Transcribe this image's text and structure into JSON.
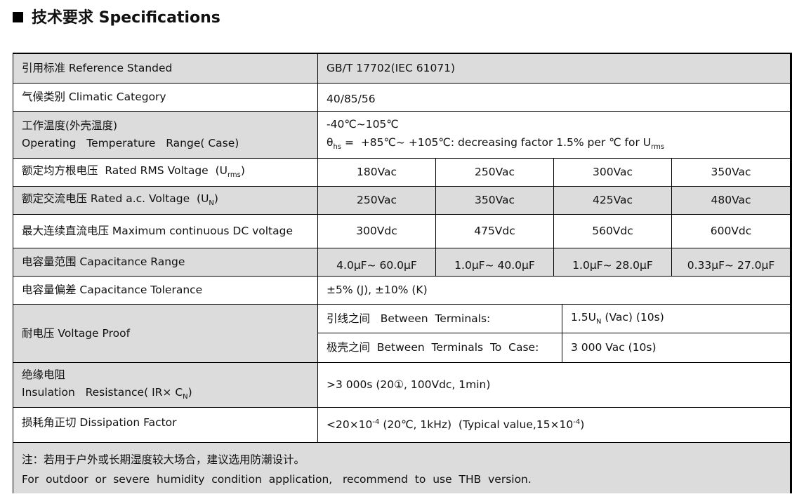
{
  "heading": {
    "bullet": "■",
    "title": "技术要求 Specifications"
  },
  "rows": {
    "reference": {
      "label": "引用标准  Reference  Standed",
      "value": "GB/T 17702(IEC 61071)"
    },
    "climatic": {
      "label": "气候类别  Climatic Category",
      "value": "40/85/56"
    },
    "temperature": {
      "label_cn": "工作温度(外壳温度)",
      "label_en": "Operating   Temperature   Range( Case)",
      "value_line1": "-40℃~105℃",
      "value_line2_pre": "θ",
      "value_line2_sub": "hs",
      "value_line2_mid": " =  +85℃~ +105℃: decreasing factor 1.5% per ℃ for U",
      "value_line2_sub2": "rms"
    },
    "rms_voltage": {
      "label_pre": "额定均方根电压  Rated RMS Voltage  (U",
      "label_sub": "rms",
      "label_post": ")",
      "values": [
        "180Vac",
        "250Vac",
        "300Vac",
        "350Vac"
      ]
    },
    "ac_voltage": {
      "label_pre": "额定交流电压 Rated a.c. Voltage  (U",
      "label_sub": "N",
      "label_post": ")",
      "values": [
        "250Vac",
        "350Vac",
        "425Vac",
        "480Vac"
      ]
    },
    "dc_voltage": {
      "label": "最大连续直流电压  Maximum  continuous  DC voltage",
      "values": [
        "300Vdc",
        "475Vdc",
        "560Vdc",
        "600Vdc"
      ]
    },
    "capacitance": {
      "label": "电容量范围  Capacitance  Range",
      "values": [
        "4.0μF~ 60.0μF",
        "1.0μF~ 40.0μF",
        "1.0μF~ 28.0μF",
        "0.33μF~ 27.0μF"
      ]
    },
    "tolerance": {
      "label": "电容量偏差  Capacitance  Tolerance",
      "value": "±5% (J), ±10% (K)"
    },
    "voltage_proof": {
      "label": "耐电压  Voltage Proof",
      "sub1_label": "引线之间   Between  Terminals:",
      "sub1_value_pre": "1.5U",
      "sub1_value_sub": "N",
      "sub1_value_post": " (Vac) (10s)",
      "sub2_label": "极壳之间  Between  Terminals  To  Case:",
      "sub2_value": "3 000 Vac (10s)"
    },
    "insulation": {
      "label_cn": "绝缘电阻",
      "label_en_pre": "Insulation   Resistance( IR× C",
      "label_en_sub": "N",
      "label_en_post": ")",
      "value": ">3 000s (20①, 100Vdc, 1min)"
    },
    "dissipation": {
      "label": "损耗角正切 Dissipation Factor",
      "value_a": "<20×10",
      "value_a_sup": "-4",
      "value_b": " (20℃, 1kHz)  (Typical value,15×10",
      "value_b_sup": "-4",
      "value_c": ")"
    }
  },
  "note": {
    "cn": "注：若用于户外或长期湿度较大场合，建议选用防潮设计。",
    "en": "For  outdoor  or  severe  humidity  condition  application,   recommend  to  use  THB  version."
  }
}
